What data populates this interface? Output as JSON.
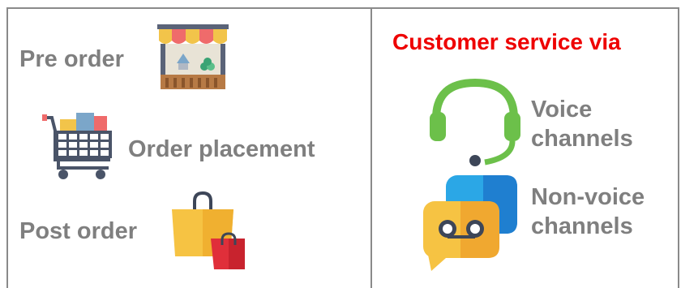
{
  "left_panel": {
    "items": [
      {
        "label": "Pre order",
        "icon": "market-stall-icon"
      },
      {
        "label": "Order placement",
        "icon": "shopping-cart-icon"
      },
      {
        "label": "Post order",
        "icon": "shopping-bags-icon"
      }
    ]
  },
  "right_panel": {
    "heading": "Customer service via",
    "heading_color": "#ee0000",
    "items": [
      {
        "line1": "Voice",
        "line2": "channels",
        "icon": "headset-icon"
      },
      {
        "line1": "Non-voice",
        "line2": "channels",
        "icon": "chat-bubbles-icon"
      }
    ]
  },
  "colors": {
    "label_gray": "#7f7f7f",
    "border_gray": "#8a8a8a"
  }
}
